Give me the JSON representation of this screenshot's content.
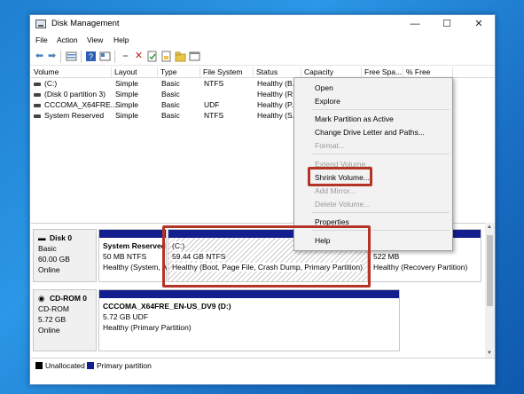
{
  "window": {
    "title": "Disk Management",
    "buttons": [
      "—",
      "☐",
      "✕"
    ]
  },
  "menu": [
    "File",
    "Action",
    "View",
    "Help"
  ],
  "toolbar": {
    "icons": [
      "back-icon",
      "forward-icon",
      "disk-list-icon",
      "help-icon",
      "properties-icon",
      "connect-icon",
      "delete-icon",
      "check-icon",
      "folder-icon",
      "new-folder-icon",
      "window-icon"
    ]
  },
  "columns": [
    "Volume",
    "Layout",
    "Type",
    "File System",
    "Status",
    "Capacity",
    "Free Spa...",
    "% Free"
  ],
  "volumes": [
    {
      "name": "(C:)",
      "layout": "Simple",
      "type": "Basic",
      "fs": "NTFS",
      "status": "Healthy (B..."
    },
    {
      "name": "(Disk 0 partition 3)",
      "layout": "Simple",
      "type": "Basic",
      "fs": "",
      "status": "Healthy (R..."
    },
    {
      "name": "CCCOMA_X64FRE...",
      "layout": "Simple",
      "type": "Basic",
      "fs": "UDF",
      "status": "Healthy (P..."
    },
    {
      "name": "System Reserved",
      "layout": "Simple",
      "type": "Basic",
      "fs": "NTFS",
      "status": "Healthy (S..."
    }
  ],
  "disks": {
    "disk0": {
      "name": "Disk 0",
      "type": "Basic",
      "size": "60.00 GB",
      "state": "Online",
      "system_reserved": {
        "name": "System Reserved",
        "size": "50 MB NTFS",
        "status": "Healthy (System, A"
      },
      "c_drive": {
        "name": "(C:)",
        "size": "59.44 GB NTFS",
        "status": "Healthy (Boot, Page File, Crash Dump, Primary Partition)"
      },
      "recovery": {
        "size": "522 MB",
        "status": "Healthy (Recovery Partition)"
      }
    },
    "cdrom0": {
      "name": "CD-ROM 0",
      "type": "CD-ROM",
      "size": "5.72 GB",
      "state": "Online",
      "volume": {
        "name": "CCCOMA_X64FRE_EN-US_DV9  (D:)",
        "size": "5.72 GB UDF",
        "status": "Healthy (Primary Partition)"
      }
    }
  },
  "legend": {
    "unallocated": "Unallocated",
    "primary": "Primary partition"
  },
  "context_menu": {
    "open": "Open",
    "explore": "Explore",
    "mark_active": "Mark Partition as Active",
    "change_letter": "Change Drive Letter and Paths...",
    "format": "Format...",
    "extend": "Extend Volume...",
    "shrink": "Shrink Volume...",
    "add_mirror": "Add Mirror...",
    "delete": "Delete Volume...",
    "properties": "Properties",
    "help": "Help"
  },
  "colors": {
    "primary": "#141f8f",
    "unallocated": "#000000",
    "highlight": "#b53428"
  }
}
